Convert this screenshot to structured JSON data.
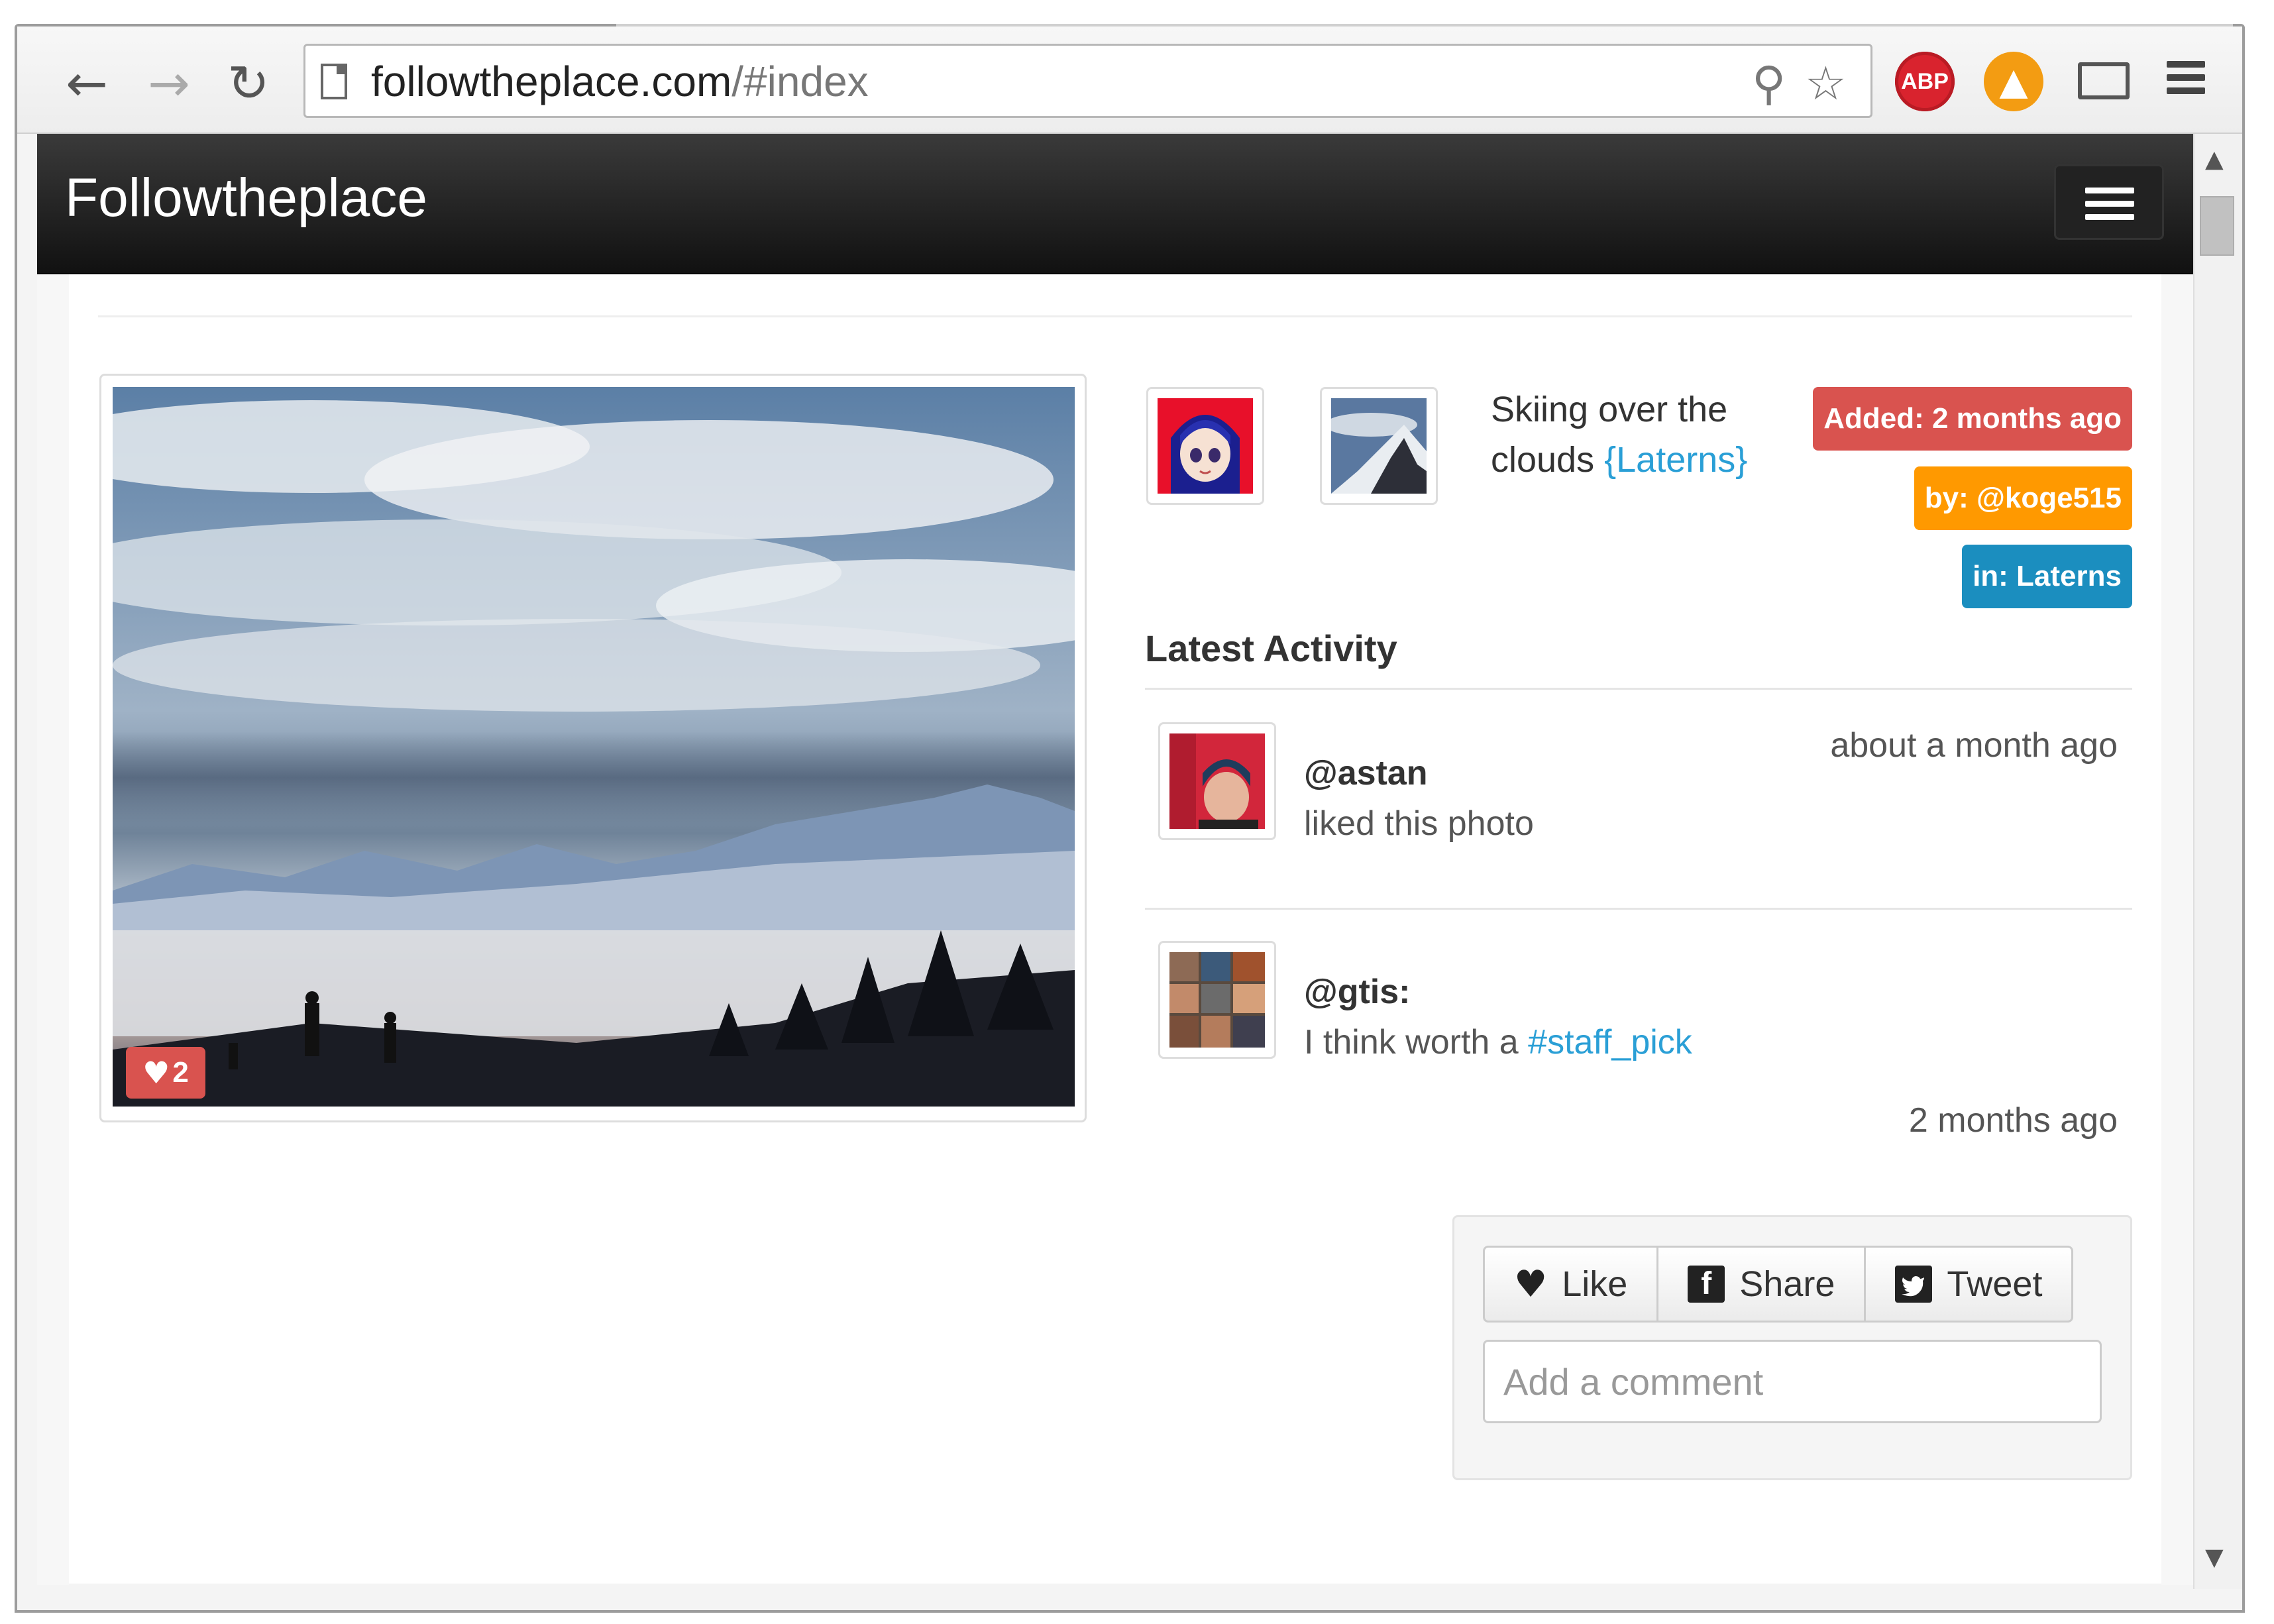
{
  "browser": {
    "url_host": "followtheplace.com",
    "url_path": "/#index",
    "abp_label": "ABP",
    "icons": [
      "back-arrow-icon",
      "forward-arrow-icon",
      "reload-icon",
      "page-icon",
      "key-icon",
      "bookmark-star-icon",
      "adblock-icon",
      "orange-extension-icon",
      "cast-icon",
      "chrome-menu-icon"
    ]
  },
  "navbar": {
    "brand": "Followtheplace"
  },
  "photo": {
    "likes": "2"
  },
  "post": {
    "title_text": "Skiing over the clouds",
    "title_tag": "{Laterns}",
    "added_label": "Added: 2 months ago",
    "by_label": "by: @koge515",
    "in_label": "in: Laterns"
  },
  "activity": {
    "heading": "Latest Activity",
    "items": [
      {
        "user": "@astan",
        "text": "liked this photo",
        "tag": "",
        "time": "about a month ago"
      },
      {
        "user": "@gtis:",
        "text": "I think worth a",
        "tag": "#staff_pick",
        "time": "2 months ago"
      }
    ]
  },
  "actions": {
    "like_label": "Like",
    "share_label": "Share",
    "tweet_label": "Tweet",
    "facebook_glyph": "f",
    "comment_placeholder": "Add a comment"
  },
  "colors": {
    "label_added": "#d9534f",
    "label_by": "#ff9900",
    "label_in": "#1b8ebf",
    "link": "#2a9fd6",
    "navbar": "#222222"
  }
}
